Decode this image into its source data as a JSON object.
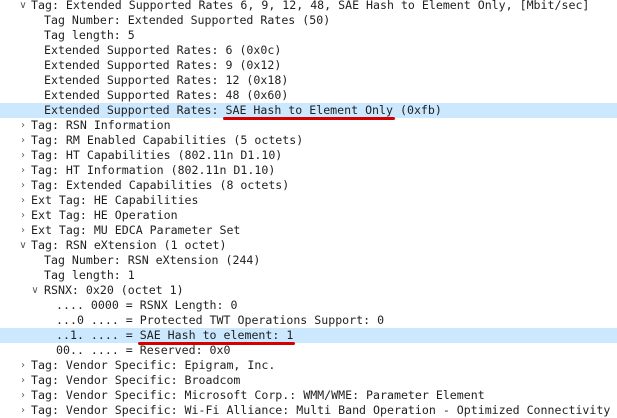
{
  "colors": {
    "selection": "#cce8ff",
    "underline": "#d40000",
    "text": "#1f1f1f",
    "arrow": "#5a5a5a"
  },
  "tree": [
    {
      "level": 0,
      "expander": "expanded",
      "text": "Tag: Extended Supported Rates 6, 9, 12, 48, SAE Hash to Element Only, [Mbit/sec]"
    },
    {
      "level": 1,
      "expander": "none",
      "text": "Tag Number: Extended Supported Rates (50)"
    },
    {
      "level": 1,
      "expander": "none",
      "text": "Tag length: 5"
    },
    {
      "level": 1,
      "expander": "none",
      "text": "Extended Supported Rates: 6 (0x0c)"
    },
    {
      "level": 1,
      "expander": "none",
      "text": "Extended Supported Rates: 9 (0x12)"
    },
    {
      "level": 1,
      "expander": "none",
      "text": "Extended Supported Rates: 12 (0x18)"
    },
    {
      "level": 1,
      "expander": "none",
      "text": "Extended Supported Rates: 48 (0x60)"
    },
    {
      "level": 1,
      "expander": "none",
      "text": "Extended Supported Rates: SAE Hash to Element Only (0xfb)",
      "selected": true,
      "highlight": "SAE Hash to Element Only"
    },
    {
      "level": 0,
      "expander": "collapsed",
      "text": "Tag: RSN Information"
    },
    {
      "level": 0,
      "expander": "collapsed",
      "text": "Tag: RM Enabled Capabilities (5 octets)"
    },
    {
      "level": 0,
      "expander": "collapsed",
      "text": "Tag: HT Capabilities (802.11n D1.10)"
    },
    {
      "level": 0,
      "expander": "collapsed",
      "text": "Tag: HT Information (802.11n D1.10)"
    },
    {
      "level": 0,
      "expander": "collapsed",
      "text": "Tag: Extended Capabilities (8 octets)"
    },
    {
      "level": 0,
      "expander": "collapsed",
      "text": "Ext Tag: HE Capabilities"
    },
    {
      "level": 0,
      "expander": "collapsed",
      "text": "Ext Tag: HE Operation"
    },
    {
      "level": 0,
      "expander": "collapsed",
      "text": "Ext Tag: MU EDCA Parameter Set"
    },
    {
      "level": 0,
      "expander": "expanded",
      "text": "Tag: RSN eXtension (1 octet)"
    },
    {
      "level": 1,
      "expander": "none",
      "text": "Tag Number: RSN eXtension (244)"
    },
    {
      "level": 1,
      "expander": "none",
      "text": "Tag length: 1"
    },
    {
      "level": 1,
      "expander": "expanded",
      "text": "RSNX: 0x20 (octet 1)"
    },
    {
      "level": 2,
      "expander": "none",
      "text": ".... 0000 = RSNX Length: 0"
    },
    {
      "level": 2,
      "expander": "none",
      "text": "...0 .... = Protected TWT Operations Support: 0"
    },
    {
      "level": 2,
      "expander": "none",
      "text": "..1. .... = SAE Hash to element: 1",
      "selected": true,
      "highlight": "SAE Hash to element: 1"
    },
    {
      "level": 2,
      "expander": "none",
      "text": "00.. .... = Reserved: 0x0"
    },
    {
      "level": 0,
      "expander": "collapsed",
      "text": "Tag: Vendor Specific: Epigram, Inc."
    },
    {
      "level": 0,
      "expander": "collapsed",
      "text": "Tag: Vendor Specific: Broadcom"
    },
    {
      "level": 0,
      "expander": "collapsed",
      "text": "Tag: Vendor Specific: Microsoft Corp.: WMM/WME: Parameter Element"
    },
    {
      "level": 0,
      "expander": "collapsed",
      "text": "Tag: Vendor Specific: Wi-Fi Alliance: Multi Band Operation - Optimized Connectivity Exp"
    }
  ]
}
